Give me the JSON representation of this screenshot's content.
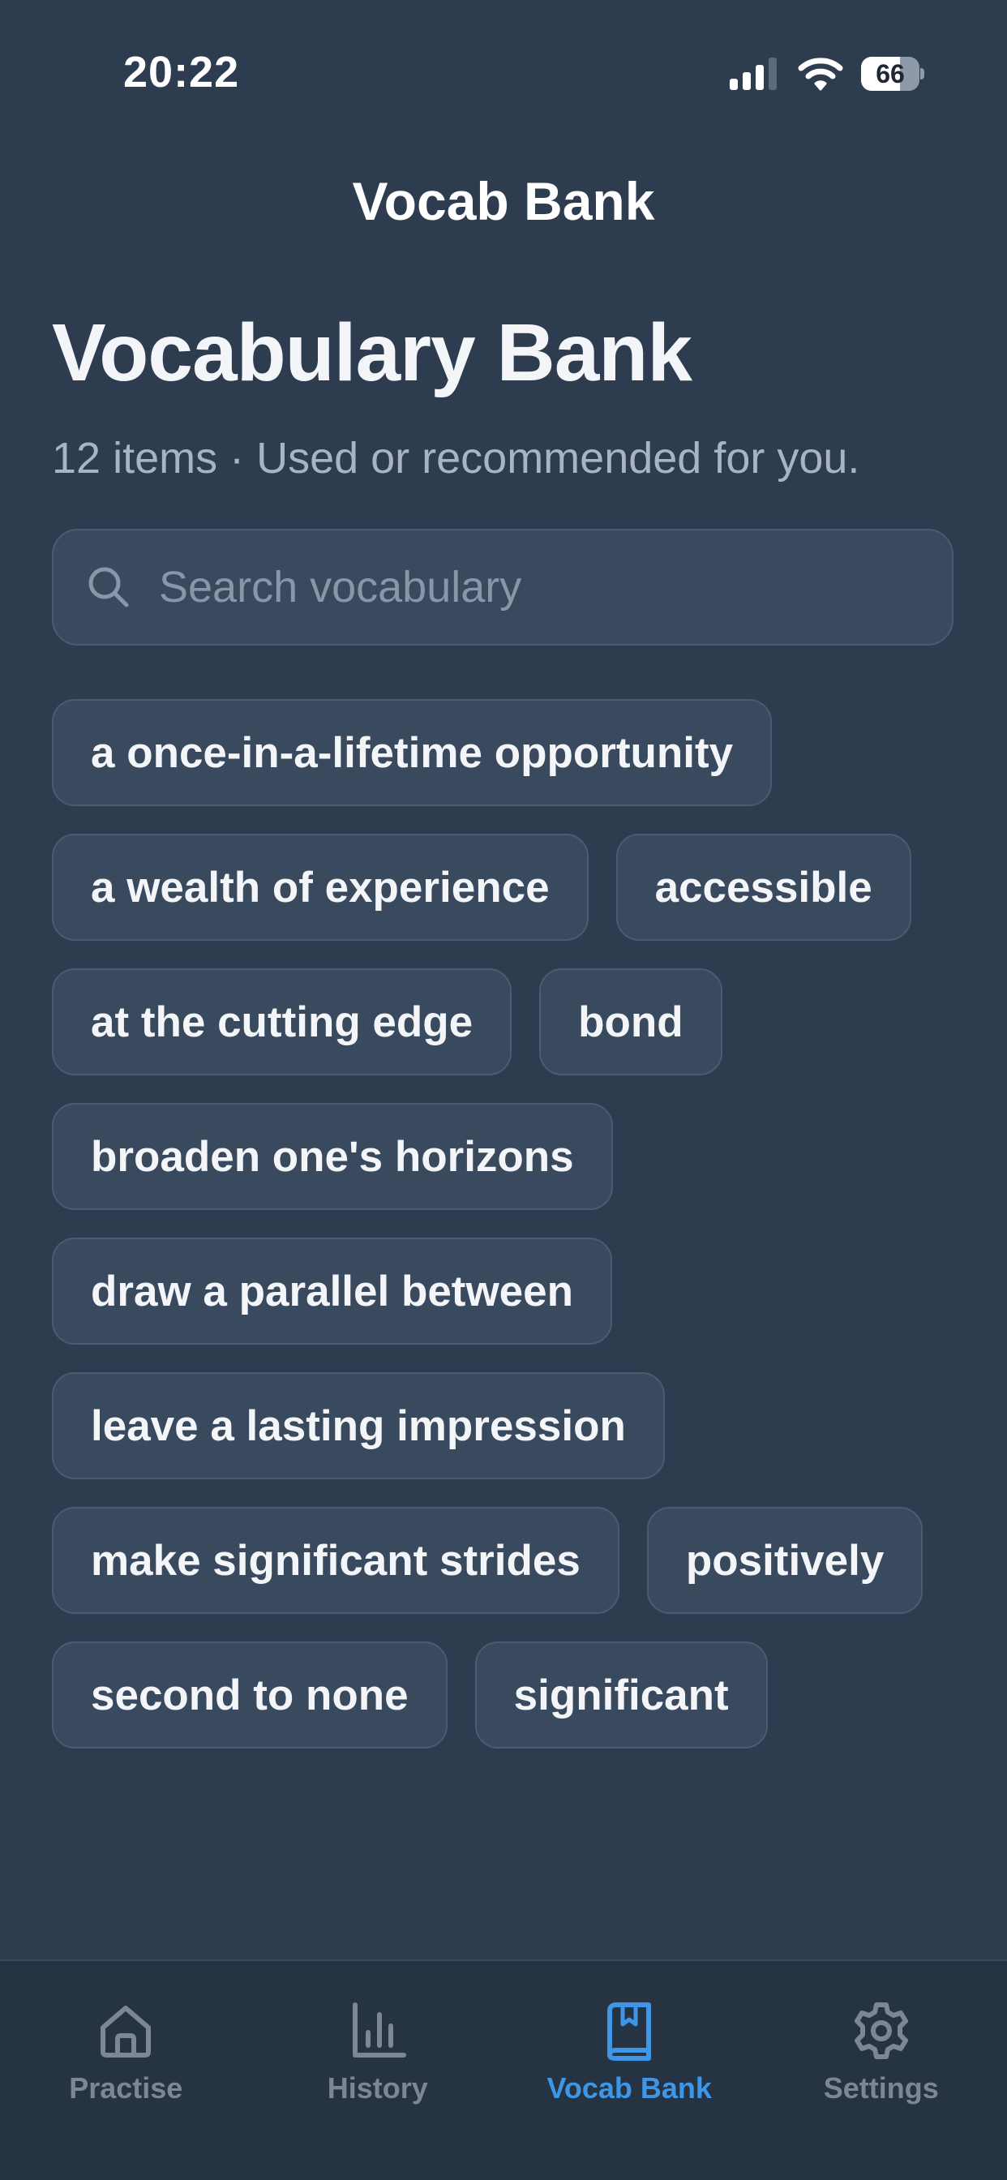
{
  "status_bar": {
    "time": "20:22",
    "battery_level": "66",
    "battery_fraction": 0.66
  },
  "header": {
    "nav_title": "Vocab Bank"
  },
  "main": {
    "title": "Vocabulary Bank",
    "subtitle": "12 items · Used or recommended for you.",
    "search": {
      "placeholder": "Search vocabulary",
      "value": "",
      "icon": "search-icon"
    },
    "items": [
      "a once-in-a-lifetime opportunity",
      "a wealth of experience",
      "accessible",
      "at the cutting edge",
      "bond",
      "broaden one's horizons",
      "draw a parallel between",
      "leave a lasting impression",
      "make significant strides",
      "positively",
      "second to none",
      "significant"
    ]
  },
  "tab_bar": {
    "tabs": [
      {
        "label": "Practise",
        "icon": "home-icon",
        "active": false
      },
      {
        "label": "History",
        "icon": "bar-chart-icon",
        "active": false
      },
      {
        "label": "Vocab Bank",
        "icon": "book-icon",
        "active": true
      },
      {
        "label": "Settings",
        "icon": "gear-icon",
        "active": false
      }
    ]
  },
  "colors": {
    "background": "#2e3c4f",
    "chip_background": "#394a5f",
    "tab_bar_background": "#263343",
    "accent": "#3e97e6",
    "inactive_tab": "#7b8797"
  }
}
